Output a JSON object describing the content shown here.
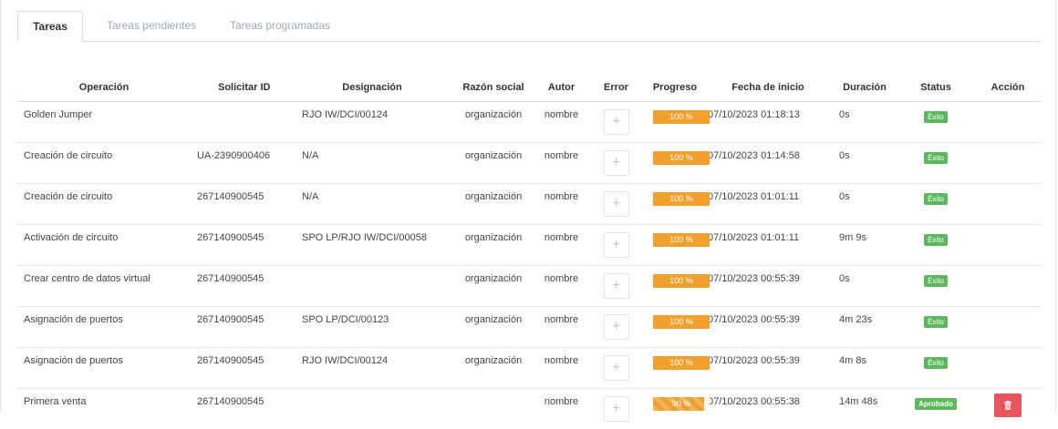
{
  "tabs": [
    {
      "label": "Tareas",
      "active": true
    },
    {
      "label": "Tareas pendientes",
      "active": false
    },
    {
      "label": "Tareas programadas",
      "active": false
    }
  ],
  "columns": {
    "operacion": "Operación",
    "solicitar_id": "Solicitar ID",
    "designacion": "Designación",
    "razon_social": "Razón social",
    "autor": "Autor",
    "error": "Error",
    "progreso": "Progreso",
    "fecha": "Fecha de inicio",
    "duracion": "Duración",
    "status": "Status",
    "accion": "Acción"
  },
  "rows": [
    {
      "operacion": "Golden Jumper",
      "solicitar_id": "",
      "designacion": "RJO IW/DCI/00124",
      "razon_social": "organización",
      "autor": "nombre",
      "error_icon": "plus-icon",
      "progress": 100,
      "progress_label": "100 %",
      "fecha": "07/10/2023 01:18:13",
      "duracion": "0s",
      "status": "Éxito",
      "action": ""
    },
    {
      "operacion": "Creación de circuito",
      "solicitar_id": "UA-2390900406",
      "designacion": "N/A",
      "razon_social": "organización",
      "autor": "nombre",
      "error_icon": "plus-icon",
      "progress": 100,
      "progress_label": "100 %",
      "fecha": "07/10/2023 01:14:58",
      "duracion": "0s",
      "status": "Éxito",
      "action": ""
    },
    {
      "operacion": "Creación de circuito",
      "solicitar_id": "267140900545",
      "designacion": "N/A",
      "razon_social": "organización",
      "autor": "nombre",
      "error_icon": "plus-icon",
      "progress": 100,
      "progress_label": "100 %",
      "fecha": "07/10/2023 01:01:11",
      "duracion": "0s",
      "status": "Éxito",
      "action": ""
    },
    {
      "operacion": "Activación de circuito",
      "solicitar_id": "267140900545",
      "designacion": "SPO LP/RJO IW/DCI/00058",
      "razon_social": "organización",
      "autor": "nombre",
      "error_icon": "plus-icon",
      "progress": 100,
      "progress_label": "100 %",
      "fecha": "07/10/2023 01:01:11",
      "duracion": "9m 9s",
      "status": "Éxito",
      "action": ""
    },
    {
      "operacion": "Crear centro de datos virtual",
      "solicitar_id": "267140900545",
      "designacion": "",
      "razon_social": "organización",
      "autor": "nombre",
      "error_icon": "plus-icon",
      "progress": 100,
      "progress_label": "100 %",
      "fecha": "07/10/2023 00:55:39",
      "duracion": "0s",
      "status": "Éxito",
      "action": ""
    },
    {
      "operacion": "Asignación de puertos",
      "solicitar_id": "267140900545",
      "designacion": "SPO LP/DCI/00123",
      "razon_social": "organización",
      "autor": "nombre",
      "error_icon": "plus-icon",
      "progress": 100,
      "progress_label": "100 %",
      "fecha": "07/10/2023 00:55:39",
      "duracion": "4m 23s",
      "status": "Éxito",
      "action": ""
    },
    {
      "operacion": "Asignación de puertos",
      "solicitar_id": "267140900545",
      "designacion": "RJO IW/DCI/00124",
      "razon_social": "organización",
      "autor": "nombre",
      "error_icon": "plus-icon",
      "progress": 100,
      "progress_label": "100 %",
      "fecha": "07/10/2023 00:55:39",
      "duracion": "4m 8s",
      "status": "Éxito",
      "action": ""
    },
    {
      "operacion": "Primera venta",
      "solicitar_id": "267140900545",
      "designacion": "",
      "razon_social": "",
      "autor": "nombre",
      "error_icon": "plus-icon",
      "progress": 90,
      "progress_label": "90 %",
      "fecha": "07/10/2023 00:55:38",
      "duracion": "14m 48s",
      "status": "Aprobado",
      "action": "trash-icon"
    }
  ],
  "colors": {
    "progress": "#f0a02c",
    "status_success": "#5cb85c",
    "delete_button": "#e8555c"
  }
}
